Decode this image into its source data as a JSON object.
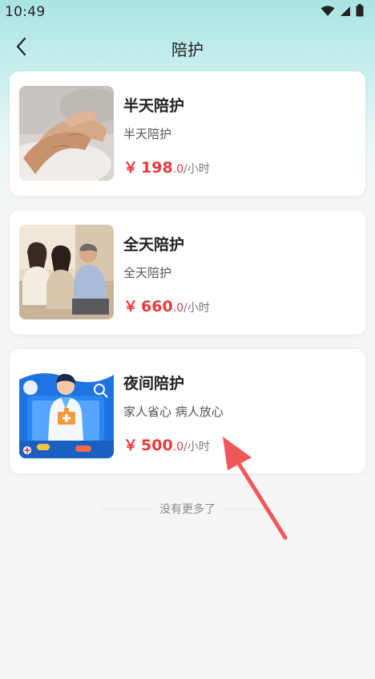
{
  "status_bar": {
    "time": "10:49",
    "icons": [
      "wifi-icon",
      "signal-icon",
      "battery-icon"
    ]
  },
  "nav": {
    "title": "陪护",
    "back_icon": "chevron-left-icon"
  },
  "services": [
    {
      "title": "半天陪护",
      "description": "半天陪护",
      "currency": "￥",
      "price_int": "198",
      "price_dec": ".0",
      "unit": "/小时"
    },
    {
      "title": "全天陪护",
      "description": "全天陪护",
      "currency": "￥",
      "price_int": "660",
      "price_dec": ".0",
      "unit": "/小时"
    },
    {
      "title": "夜间陪护",
      "description": "家人省心 病人放心",
      "currency": "￥",
      "price_int": "500",
      "price_dec": ".0",
      "unit": "/小时"
    }
  ],
  "footer": {
    "no_more": "没有更多了"
  },
  "colors": {
    "price": "#e9393b",
    "header_gradient_top": "#a8e4e2",
    "background": "#f5f5f5",
    "annotation_arrow": "#f0575a"
  }
}
